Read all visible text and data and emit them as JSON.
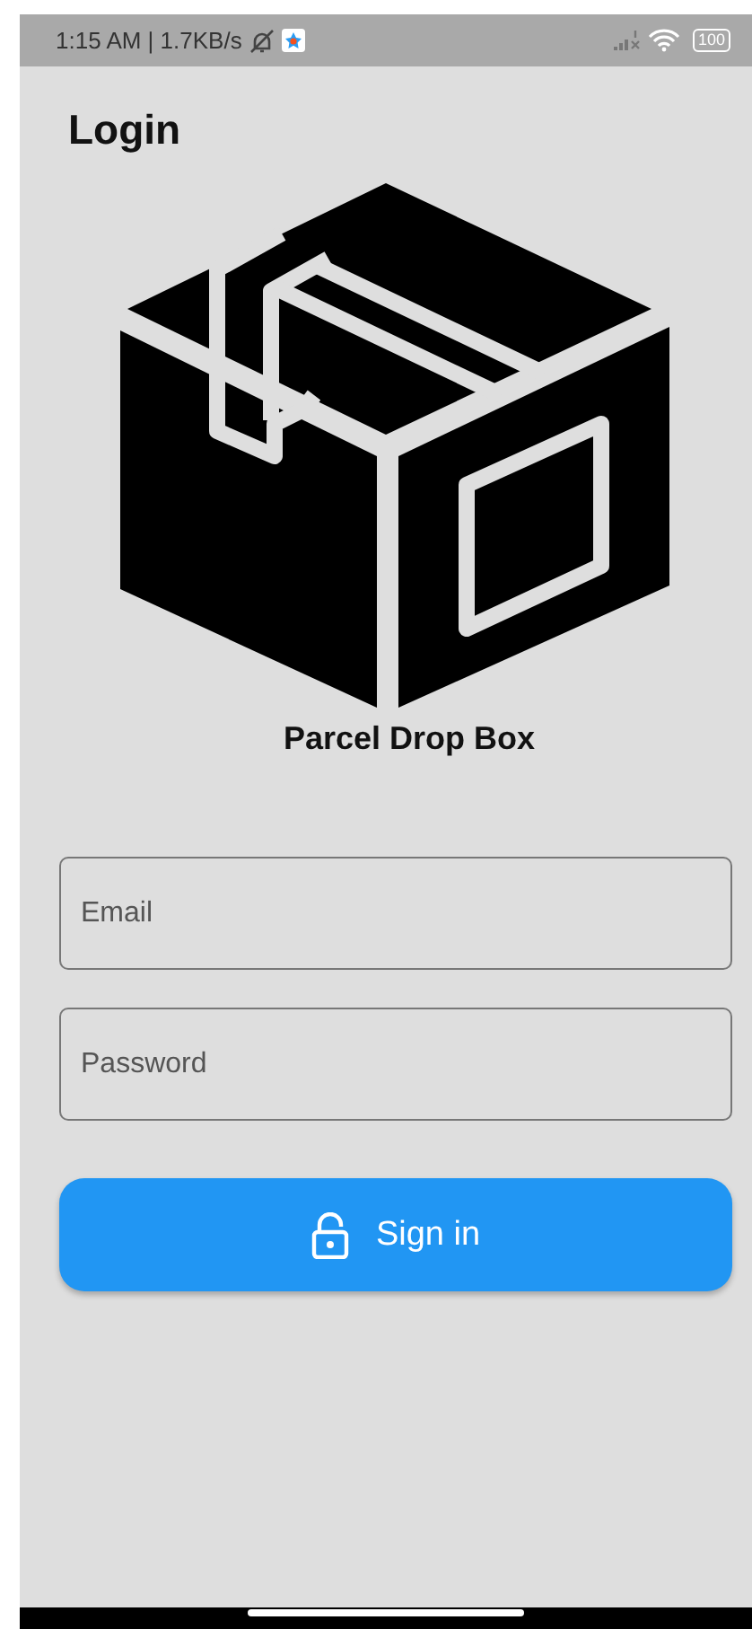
{
  "status_bar": {
    "time": "1:15 AM | 1.7KB/s",
    "battery": "100"
  },
  "header": {
    "title": "Login"
  },
  "logo": {
    "caption": "Parcel Drop Box"
  },
  "fields": [
    {
      "placeholder": "Email"
    },
    {
      "placeholder": "Password"
    }
  ],
  "button": {
    "label": "Sign in"
  }
}
